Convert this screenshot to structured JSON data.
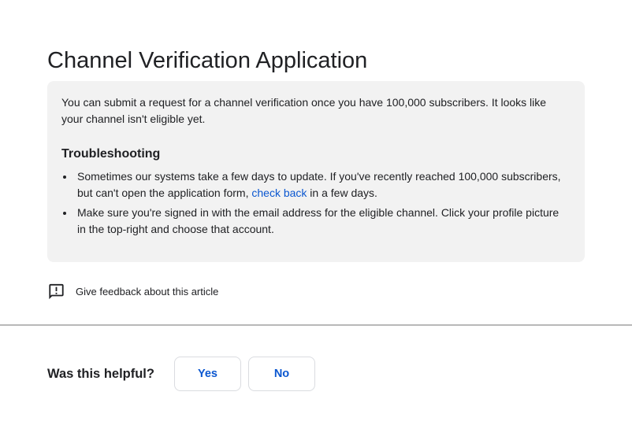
{
  "page": {
    "title": "Channel Verification Application"
  },
  "notice_card": {
    "intro": "You can submit a request for a channel verification once you have 100,000 subscribers. It looks like your channel isn't eligible yet.",
    "troubleshooting": {
      "heading": "Troubleshooting",
      "bullets": [
        {
          "before_link": "Sometimes our systems take a few days to update. If you've recently reached 100,000 subscribers, but can't open the application form, ",
          "link": "check back",
          "after_link": " in a few days."
        },
        {
          "text": "Make sure you're signed in with the email address for the eligible channel. Click your profile picture in the top-right and choose that account."
        }
      ]
    }
  },
  "feedback": {
    "icon": "feedback-bubble-icon",
    "label": "Give feedback about this article"
  },
  "helpful": {
    "question": "Was this helpful?",
    "yes_label": "Yes",
    "no_label": "No"
  },
  "colors": {
    "accent_blue": "#0b57d0",
    "card_background": "#f2f2f2",
    "text": "#202124",
    "button_border": "#dadce0",
    "divider": "#b9b9b9"
  }
}
